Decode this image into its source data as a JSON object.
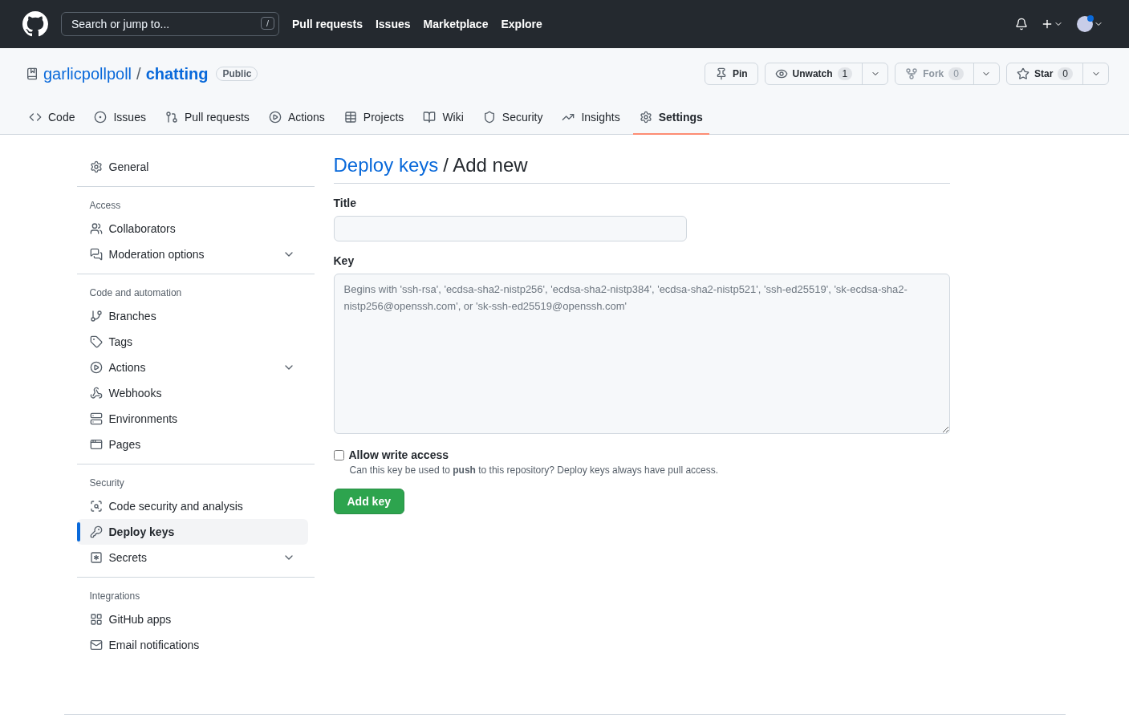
{
  "topbar": {
    "search": {
      "placeholder": "Search or jump to...",
      "shortcut": "/"
    },
    "nav": [
      "Pull requests",
      "Issues",
      "Marketplace",
      "Explore"
    ]
  },
  "repo": {
    "owner": "garlicpollpoll",
    "separator": "/",
    "name": "chatting",
    "visibility": "Public",
    "actions": [
      {
        "label": "Pin",
        "disabled": false
      },
      {
        "label": "Unwatch",
        "count": "1",
        "disabled": false
      },
      {
        "label": "Fork",
        "count": "0",
        "disabled": true
      },
      {
        "label": "Star",
        "count": "0",
        "disabled": false
      }
    ]
  },
  "tabs": [
    {
      "label": "Code",
      "selected": false
    },
    {
      "label": "Issues",
      "selected": false
    },
    {
      "label": "Pull requests",
      "selected": false
    },
    {
      "label": "Actions",
      "selected": false
    },
    {
      "label": "Projects",
      "selected": false
    },
    {
      "label": "Wiki",
      "selected": false
    },
    {
      "label": "Security",
      "selected": false
    },
    {
      "label": "Insights",
      "selected": false
    },
    {
      "label": "Settings",
      "selected": true
    }
  ],
  "sidebar": {
    "groups": [
      {
        "items": [
          {
            "label": "General",
            "selected": false
          }
        ]
      },
      {
        "heading": "Access",
        "items": [
          {
            "label": "Collaborators",
            "selected": false
          },
          {
            "label": "Moderation options",
            "selected": false,
            "expanded": false
          }
        ]
      },
      {
        "heading": "Code and automation",
        "items": [
          {
            "label": "Branches",
            "selected": false
          },
          {
            "label": "Tags",
            "selected": false
          },
          {
            "label": "Actions",
            "selected": false,
            "expanded": false
          },
          {
            "label": "Webhooks",
            "selected": false
          },
          {
            "label": "Environments",
            "selected": false
          },
          {
            "label": "Pages",
            "selected": false
          }
        ]
      },
      {
        "heading": "Security",
        "items": [
          {
            "label": "Code security and analysis",
            "selected": false
          },
          {
            "label": "Deploy keys",
            "selected": true
          },
          {
            "label": "Secrets",
            "selected": false,
            "expanded": false
          }
        ]
      },
      {
        "heading": "Integrations",
        "items": [
          {
            "label": "GitHub apps",
            "selected": false
          },
          {
            "label": "Email notifications",
            "selected": false
          }
        ]
      }
    ]
  },
  "main": {
    "breadcrumb_link": "Deploy keys",
    "title": "/ Add new",
    "title_field": {
      "label": "Title"
    },
    "key_field": {
      "label": "Key",
      "placeholder": "Begins with 'ssh-rsa', 'ecdsa-sha2-nistp256', 'ecdsa-sha2-nistp384', 'ecdsa-sha2-nistp521', 'ssh-ed25519', 'sk-ecdsa-sha2-nistp256@openssh.com', or 'sk-ssh-ed25519@openssh.com'"
    },
    "write_access": {
      "label": "Allow write access",
      "checked": false,
      "note": "Can this key be used to **push** to this repository? Deploy keys always have pull access."
    },
    "submit": "Add key"
  }
}
